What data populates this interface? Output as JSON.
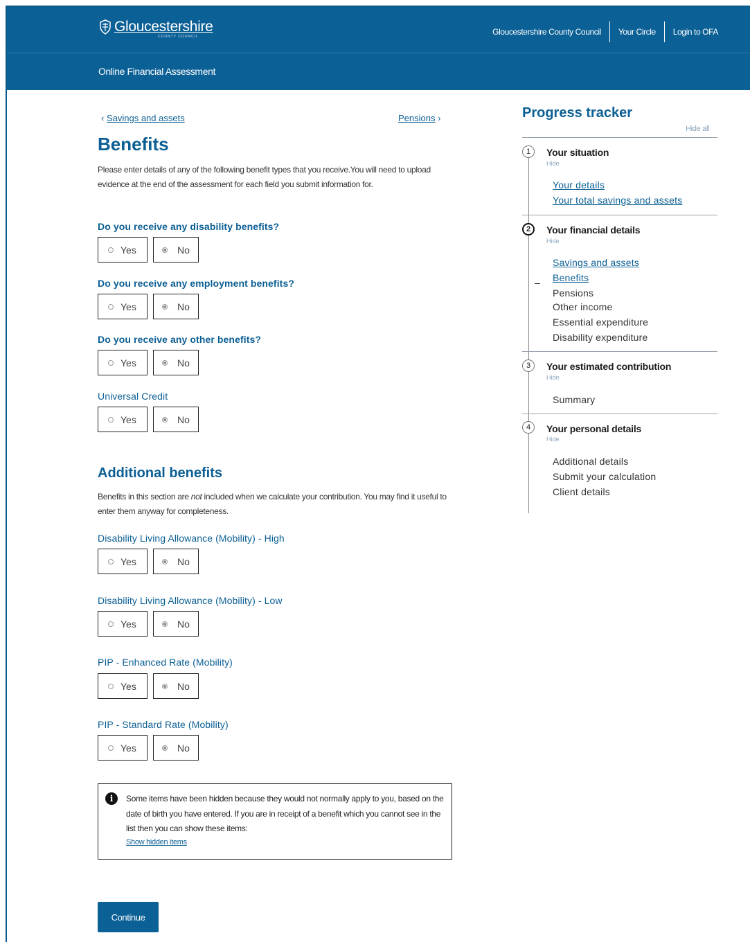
{
  "header": {
    "logo_text": "Gloucestershire",
    "logo_subtext": "COUNTY COUNCIL",
    "links": [
      "Gloucestershire County Council",
      "Your Circle",
      "Login to OFA"
    ],
    "subtitle": "Online Financial Assessment"
  },
  "nav": {
    "prev_arrow": "‹",
    "prev_label": "Savings and assets",
    "next_label": "Pensions",
    "next_arrow": "›"
  },
  "main": {
    "title": "Benefits",
    "intro": "Please enter details of any of the following benefit types that you receive.You will need to upload evidence at the end of the assessment for each field you submit information for.",
    "yes_label": "Yes",
    "no_label": "No",
    "questions": [
      {
        "label": "Do you receive any disability benefits?",
        "selected": "No"
      },
      {
        "label": "Do you receive any employment benefits?",
        "selected": "No"
      },
      {
        "label": "Do you receive any other benefits?",
        "selected": "No"
      },
      {
        "label": "Universal Credit",
        "selected": "No"
      }
    ],
    "additional_title": "Additional benefits",
    "additional_intro_pre": "Benefits in this section are ",
    "additional_intro_em": "not",
    "additional_intro_post": " included when we calculate your contribution. You may find it useful to enter them anyway for completeness.",
    "additional_questions": [
      {
        "label": "Disability Living Allowance (Mobility) - High",
        "selected": "No"
      },
      {
        "label": "Disability Living Allowance (Mobility) - Low",
        "selected": "No"
      },
      {
        "label": "PIP - Enhanced Rate (Mobility)",
        "selected": "No"
      },
      {
        "label": "PIP - Standard Rate (Mobility)",
        "selected": "No"
      }
    ],
    "info_icon": "i",
    "info_text": "Some items have been hidden because they would not normally apply to you, based on the date of birth you have entered. If you are in receipt of a benefit which you cannot see in the list then you can show these items:",
    "show_hidden": "Show hidden items",
    "continue": "Continue"
  },
  "progress": {
    "title": "Progress tracker",
    "hide_all": "Hide all",
    "hide": "Hide",
    "sections": [
      {
        "num": "1",
        "title": "Your situation",
        "items": [
          "Your details",
          "Your total savings and assets"
        ]
      },
      {
        "num": "2",
        "title": "Your financial details",
        "items": [
          "Savings and assets",
          "Benefits",
          "Pensions",
          "Other income",
          "Essential expenditure",
          "Disability expenditure"
        ]
      },
      {
        "num": "3",
        "title": "Your estimated contribution",
        "items": [
          "Summary"
        ]
      },
      {
        "num": "4",
        "title": "Your personal details",
        "items": [
          "Additional details",
          "Submit your calculation",
          "Client details"
        ]
      }
    ],
    "current_marker": "–"
  }
}
